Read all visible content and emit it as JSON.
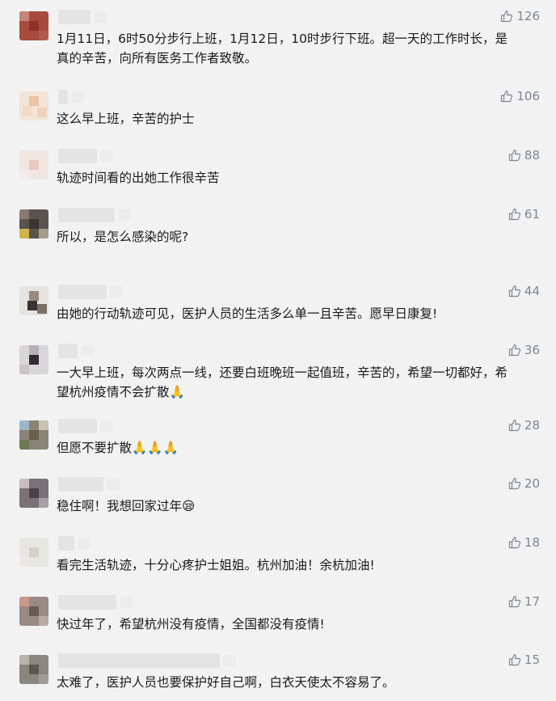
{
  "comments": [
    {
      "text": "1月11日，6时50分步行上班，1月12日，10时步行下班。超一天的工作时长，是\n真的辛苦，向所有医务工作者致敬。",
      "likes": "126"
    },
    {
      "text": "这么早上班，辛苦的护士",
      "likes": "106"
    },
    {
      "text": "轨迹时间看的出她工作很辛苦",
      "likes": "88"
    },
    {
      "text": "所以，是怎么感染的呢?",
      "likes": "61"
    },
    {
      "text": "由她的行动轨迹可见，医护人员的生活多么单一且辛苦。愿早日康复!",
      "likes": "44"
    },
    {
      "text": "一大早上班，每次两点一线，还要白班晚班一起值班，辛苦的，希望一切都好，希\n望杭州疫情不会扩散🙏",
      "likes": "36"
    },
    {
      "text": "但愿不要扩散🙏🙏🙏",
      "likes": "28"
    },
    {
      "text": "稳住啊！我想回家过年😪",
      "likes": "20"
    },
    {
      "text": "看完生活轨迹，十分心疼护士姐姐。杭州加油！余杭加油!",
      "likes": "18"
    },
    {
      "text": "快过年了，希望杭州没有疫情，全国都没有疫情!",
      "likes": "17"
    },
    {
      "text": "太难了，医护人员也要保护好自己啊，白衣天使太不容易了。",
      "likes": "15"
    }
  ],
  "icon": "thumbs-up-icon",
  "colors": {
    "background": "#f2f2f2",
    "text": "#1a1a1a",
    "like": "#7d8794"
  }
}
